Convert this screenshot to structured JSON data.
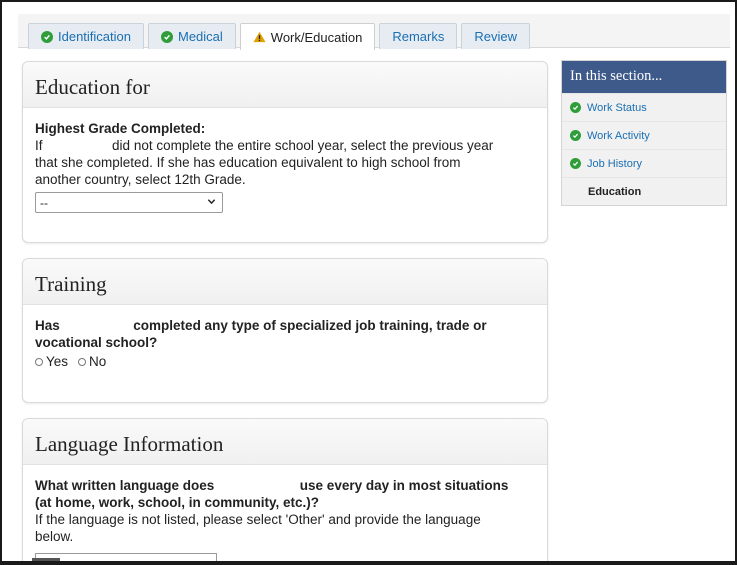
{
  "tabs": [
    {
      "label": "Identification",
      "status": "complete"
    },
    {
      "label": "Medical",
      "status": "complete"
    },
    {
      "label": "Work/Education",
      "status": "warning",
      "active": true
    },
    {
      "label": "Remarks",
      "status": "none"
    },
    {
      "label": "Review",
      "status": "none"
    }
  ],
  "education": {
    "title": "Education for",
    "question": "Highest Grade Completed:",
    "help_line1_a": "If",
    "help_line1_b": "did not complete the entire school year, select the previous year",
    "help_line2": "that she completed. If she has education equivalent to high school from",
    "help_line3": "another country, select 12th Grade.",
    "select_value": "--"
  },
  "training": {
    "title": "Training",
    "question_a": "Has",
    "question_b": "completed any type of specialized job training, trade or",
    "question_line2": "vocational school?",
    "option_yes": "Yes",
    "option_no": "No"
  },
  "language": {
    "title": "Language Information",
    "question_a": "What written language does",
    "question_b": "use every day in most situations",
    "question_line2": "(at home, work, school, in community, etc.)?",
    "help_line1": "If the language is not listed, please select 'Other' and provide the language",
    "help_line2": "below."
  },
  "sidebar": {
    "heading": "In this section...",
    "items": [
      {
        "label": "Work Status",
        "status": "complete"
      },
      {
        "label": "Work Activity",
        "status": "complete"
      },
      {
        "label": "Job History",
        "status": "complete"
      },
      {
        "label": "Education",
        "status": "current"
      }
    ]
  },
  "colors": {
    "accent": "#1a6fb3",
    "check": "#2f9e3a",
    "warning": "#e0a100",
    "sidebar_header": "#3d5a8a"
  }
}
